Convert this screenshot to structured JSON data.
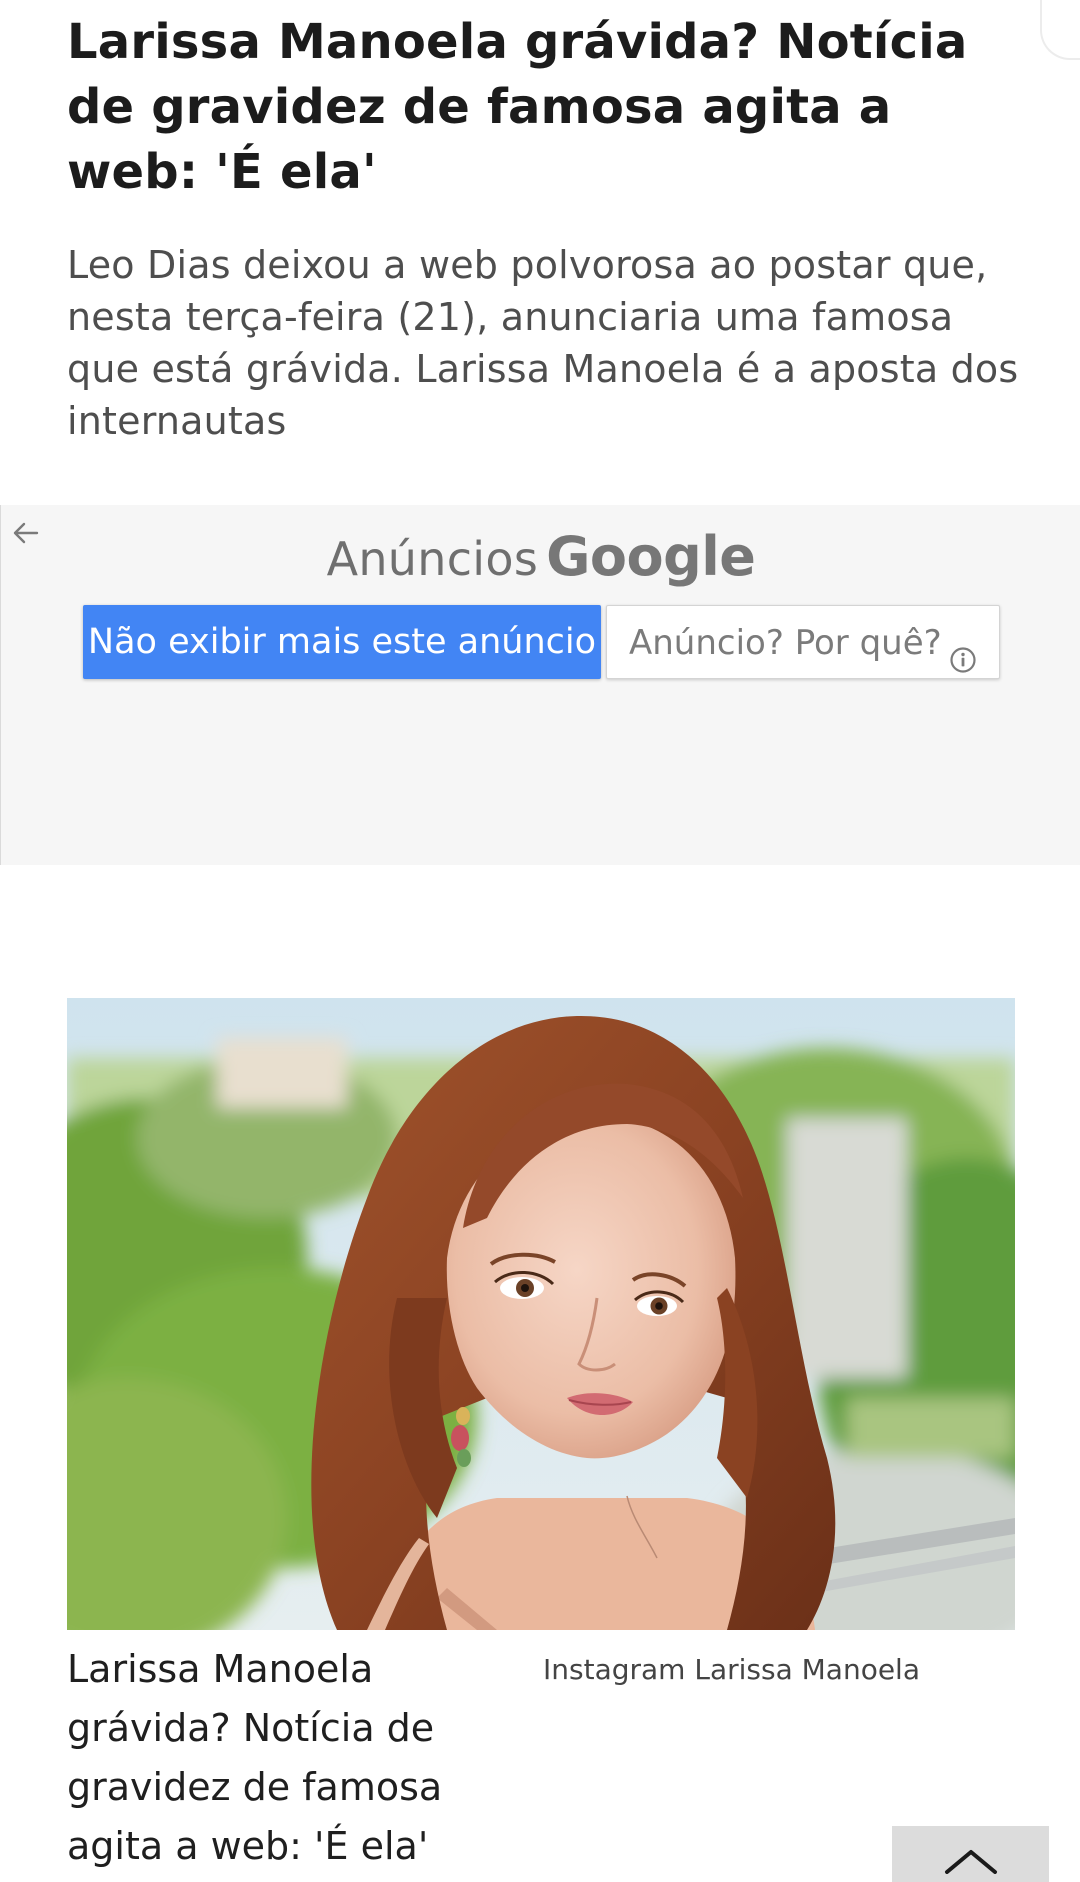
{
  "article": {
    "title": "Larissa Manoela grávida? Notícia de gravidez de famosa agita a web: 'É ela'",
    "subtitle": "Leo Dias deixou a web polvorosa ao postar que, nesta terça-feira (21), anunciaria uma famosa que está grávida. Larissa Manoela é a aposta dos internautas"
  },
  "ad": {
    "heading_label": "Anúncios",
    "heading_brand": "Google",
    "stop_button_label": "Não exibir mais este anúncio",
    "why_button_label": "Anúncio? Por quê?",
    "back_icon": "arrow-left-icon",
    "info_icon": "info-circle-icon",
    "colors": {
      "panel_background": "#f6f6f6",
      "primary_button": "#4285f4",
      "heading_text": "#6f6f6f"
    }
  },
  "photo": {
    "caption": "Larissa Manoela grávida? Notícia de gravidez de famosa agita a web: 'É ela'",
    "credit": "Instagram Larissa Manoela"
  },
  "controls": {
    "scroll_top_icon": "chevron-up-icon"
  }
}
